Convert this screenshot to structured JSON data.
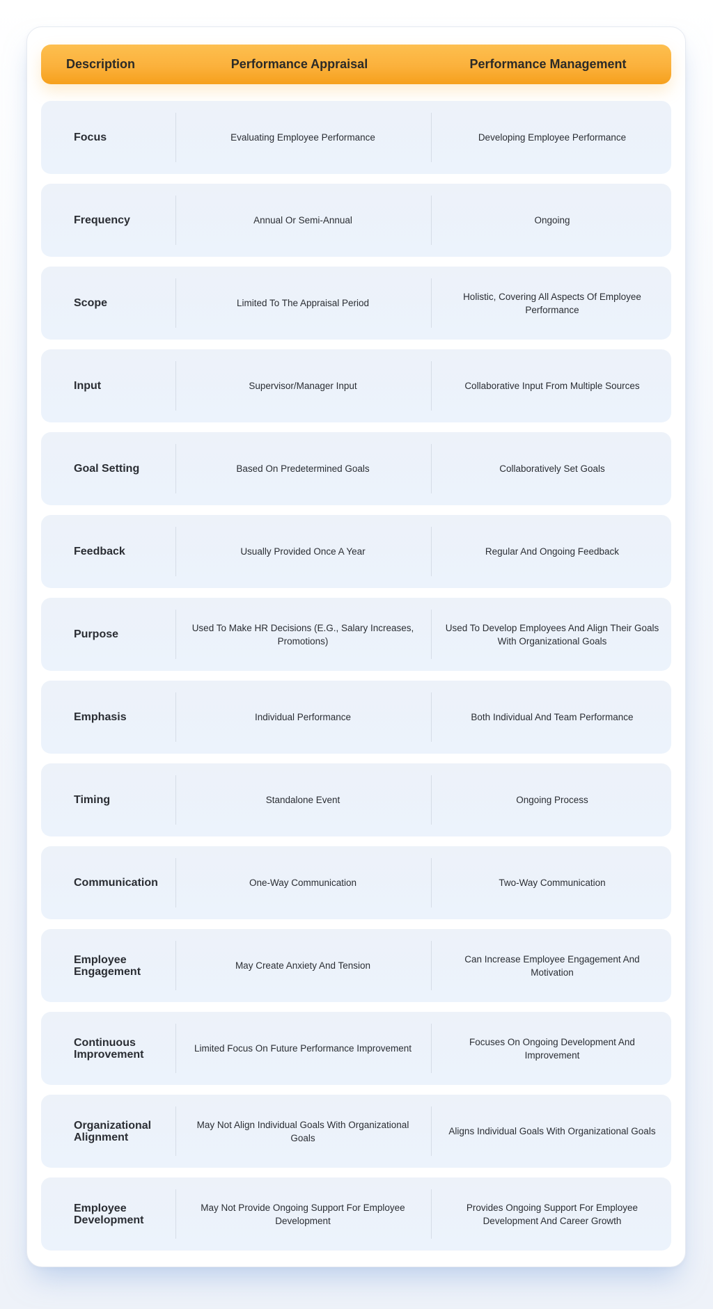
{
  "table": {
    "headers": {
      "description": "Description",
      "performance_appraisal": "Performance Appraisal",
      "performance_management": "Performance Management"
    },
    "colors": {
      "header_accent": "#fbb13c",
      "row_background": "#edf2f9",
      "text": "#2a2d33"
    },
    "rows": [
      {
        "description": "Focus",
        "performance_appraisal": "Evaluating Employee Performance",
        "performance_management": "Developing Employee Performance"
      },
      {
        "description": "Frequency",
        "performance_appraisal": "Annual Or Semi-Annual",
        "performance_management": "Ongoing"
      },
      {
        "description": "Scope",
        "performance_appraisal": "Limited To The Appraisal Period",
        "performance_management": "Holistic, Covering All Aspects Of Employee Performance"
      },
      {
        "description": "Input",
        "performance_appraisal": "Supervisor/Manager Input",
        "performance_management": "Collaborative Input From Multiple Sources"
      },
      {
        "description": "Goal Setting",
        "performance_appraisal": "Based On Predetermined Goals",
        "performance_management": "Collaboratively Set Goals"
      },
      {
        "description": "Feedback",
        "performance_appraisal": "Usually Provided Once A Year",
        "performance_management": "Regular And Ongoing Feedback"
      },
      {
        "description": "Purpose",
        "performance_appraisal": "Used To Make HR Decisions (E.G., Salary Increases, Promotions)",
        "performance_management": "Used To Develop Employees And Align Their Goals With Organizational Goals"
      },
      {
        "description": "Emphasis",
        "performance_appraisal": "Individual Performance",
        "performance_management": "Both Individual And Team Performance"
      },
      {
        "description": "Timing",
        "performance_appraisal": "Standalone Event",
        "performance_management": "Ongoing Process"
      },
      {
        "description": "Communication",
        "performance_appraisal": "One-Way Communication",
        "performance_management": "Two-Way Communication"
      },
      {
        "description": "Employee Engagement",
        "performance_appraisal": "May Create Anxiety And Tension",
        "performance_management": "Can Increase Employee Engagement And Motivation"
      },
      {
        "description": "Continuous Improvement",
        "performance_appraisal": "Limited Focus On Future Performance Improvement",
        "performance_management": "Focuses On Ongoing Development And Improvement"
      },
      {
        "description": "Organizational Alignment",
        "performance_appraisal": "May Not Align Individual Goals With Organizational Goals",
        "performance_management": "Aligns Individual Goals With Organizational Goals"
      },
      {
        "description": "Employee Development",
        "performance_appraisal": "May Not Provide Ongoing Support For Employee Development",
        "performance_management": "Provides Ongoing Support For Employee Development And Career Growth"
      }
    ]
  }
}
